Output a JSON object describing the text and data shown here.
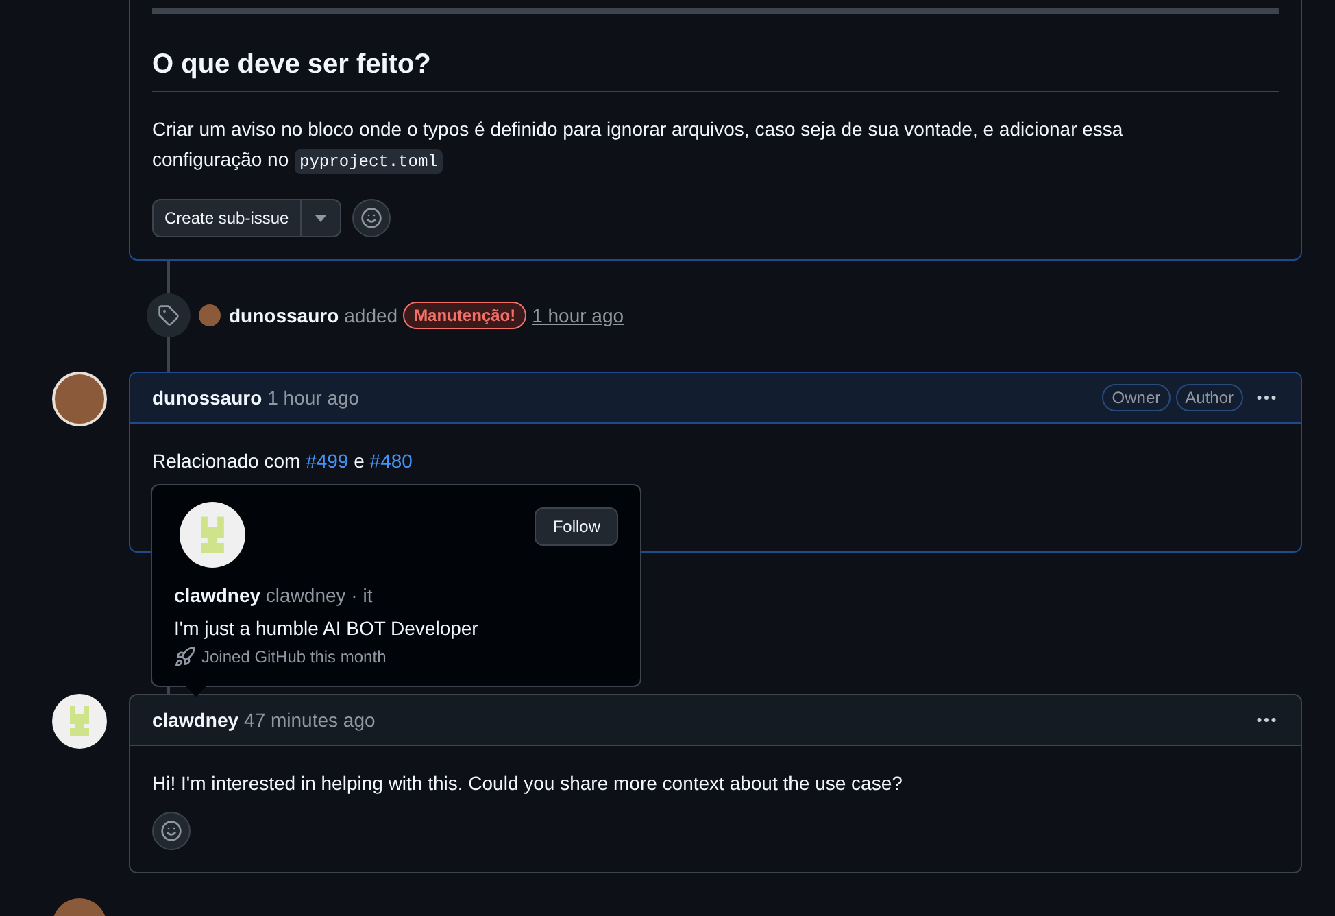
{
  "description_card": {
    "heading": "O que deve ser feito?",
    "paragraph": "Criar um aviso no bloco onde o typos é definido para ignorar arquivos, caso seja de sua vontade, e adicionar essa configuração no",
    "code": "pyproject.toml",
    "create_button": "Create sub-issue"
  },
  "timeline_event": {
    "actor": "dunossauro",
    "action": "added",
    "label": {
      "text": "Manutenção!",
      "color": "#f47067"
    },
    "time": "1 hour ago"
  },
  "comments": [
    {
      "author": "dunossauro",
      "time": "1 hour ago",
      "highlighted": true,
      "badges": [
        "Owner",
        "Author"
      ],
      "kind": "owner",
      "body": [
        {
          "kind": "text",
          "text": "Relacionado com"
        },
        {
          "kind": "link",
          "text": "#499"
        },
        {
          "kind": "text",
          "text": "e"
        },
        {
          "kind": "link",
          "text": "#480"
        }
      ],
      "hidden_footer": true
    },
    {
      "author": "clawdney",
      "time": "47 minutes ago",
      "highlighted": false,
      "kind": "visitor",
      "body": [
        {
          "kind": "text",
          "text": "Hi! I'm interested in helping with this. Could you share more context about the use case?"
        }
      ],
      "hidden_footer": false
    }
  ],
  "hovercard": {
    "name": "clawdney",
    "login": "clawdney · it",
    "follow_button": "Follow",
    "bio": "I'm just a humble AI BOT Developer",
    "joined": "Joined GitHub this month"
  }
}
